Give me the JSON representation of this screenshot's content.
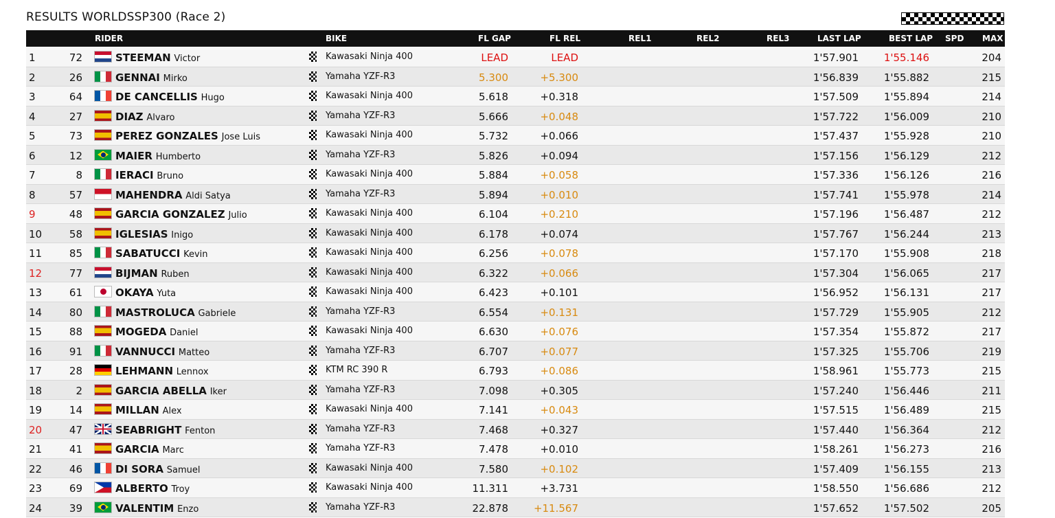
{
  "title": "RESULTS WORLDSSP300  (Race 2)",
  "headers": {
    "rider": "RIDER",
    "bike": "BIKE",
    "fl_gap": "FL GAP",
    "fl_rel": "FL REL",
    "rel1": "REL1",
    "rel2": "REL2",
    "rel3": "REL3",
    "last_lap": "LAST LAP",
    "best_lap": "BEST LAP",
    "spd": "SPD",
    "max": "MAX"
  },
  "rows": [
    {
      "pos": "1",
      "num": "72",
      "flag": "NL",
      "last": "STEEMAN",
      "first": "Victor",
      "bike": "Kawasaki Ninja 400",
      "gap": "LEAD",
      "rel": "LEAD",
      "last_lap": "1'57.901",
      "best_lap": "1'55.146",
      "max": "204"
    },
    {
      "pos": "2",
      "num": "26",
      "flag": "IT",
      "last": "GENNAI",
      "first": "Mirko",
      "bike": "Yamaha YZF-R3",
      "gap": "5.300",
      "rel": "+5.300",
      "last_lap": "1'56.839",
      "best_lap": "1'55.882",
      "max": "215"
    },
    {
      "pos": "3",
      "num": "64",
      "flag": "FR",
      "last": "DE CANCELLIS",
      "first": "Hugo",
      "bike": "Kawasaki Ninja 400",
      "gap": "5.618",
      "rel": "+0.318",
      "last_lap": "1'57.509",
      "best_lap": "1'55.894",
      "max": "214"
    },
    {
      "pos": "4",
      "num": "27",
      "flag": "ES",
      "last": "DIAZ",
      "first": "Alvaro",
      "bike": "Yamaha YZF-R3",
      "gap": "5.666",
      "rel": "+0.048",
      "last_lap": "1'57.722",
      "best_lap": "1'56.009",
      "max": "210"
    },
    {
      "pos": "5",
      "num": "73",
      "flag": "ES",
      "last": "PEREZ GONZALES",
      "first": "Jose Luis",
      "bike": "Kawasaki Ninja 400",
      "gap": "5.732",
      "rel": "+0.066",
      "last_lap": "1'57.437",
      "best_lap": "1'55.928",
      "max": "210"
    },
    {
      "pos": "6",
      "num": "12",
      "flag": "BR",
      "last": "MAIER",
      "first": "Humberto",
      "bike": "Yamaha YZF-R3",
      "gap": "5.826",
      "rel": "+0.094",
      "last_lap": "1'57.156",
      "best_lap": "1'56.129",
      "max": "212"
    },
    {
      "pos": "7",
      "num": "8",
      "flag": "IT",
      "last": "IERACI",
      "first": "Bruno",
      "bike": "Kawasaki Ninja 400",
      "gap": "5.884",
      "rel": "+0.058",
      "last_lap": "1'57.336",
      "best_lap": "1'56.126",
      "max": "216"
    },
    {
      "pos": "8",
      "num": "57",
      "flag": "ID",
      "last": "MAHENDRA",
      "first": "Aldi Satya",
      "bike": "Yamaha YZF-R3",
      "gap": "5.894",
      "rel": "+0.010",
      "last_lap": "1'57.741",
      "best_lap": "1'55.978",
      "max": "214"
    },
    {
      "pos": "9",
      "num": "48",
      "flag": "ES",
      "last": "GARCIA GONZALEZ",
      "first": "Julio",
      "bike": "Kawasaki Ninja 400",
      "gap": "6.104",
      "rel": "+0.210",
      "last_lap": "1'57.196",
      "best_lap": "1'56.487",
      "max": "212"
    },
    {
      "pos": "10",
      "num": "58",
      "flag": "ES",
      "last": "IGLESIAS",
      "first": "Inigo",
      "bike": "Kawasaki Ninja 400",
      "gap": "6.178",
      "rel": "+0.074",
      "last_lap": "1'57.767",
      "best_lap": "1'56.244",
      "max": "213"
    },
    {
      "pos": "11",
      "num": "85",
      "flag": "IT",
      "last": "SABATUCCI",
      "first": "Kevin",
      "bike": "Kawasaki Ninja 400",
      "gap": "6.256",
      "rel": "+0.078",
      "last_lap": "1'57.170",
      "best_lap": "1'55.908",
      "max": "218"
    },
    {
      "pos": "12",
      "num": "77",
      "flag": "NL",
      "last": "BIJMAN",
      "first": "Ruben",
      "bike": "Kawasaki Ninja 400",
      "gap": "6.322",
      "rel": "+0.066",
      "last_lap": "1'57.304",
      "best_lap": "1'56.065",
      "max": "217"
    },
    {
      "pos": "13",
      "num": "61",
      "flag": "JP",
      "last": "OKAYA",
      "first": "Yuta",
      "bike": "Kawasaki Ninja 400",
      "gap": "6.423",
      "rel": "+0.101",
      "last_lap": "1'56.952",
      "best_lap": "1'56.131",
      "max": "217"
    },
    {
      "pos": "14",
      "num": "80",
      "flag": "IT",
      "last": "MASTROLUCA",
      "first": "Gabriele",
      "bike": "Yamaha YZF-R3",
      "gap": "6.554",
      "rel": "+0.131",
      "last_lap": "1'57.729",
      "best_lap": "1'55.905",
      "max": "212"
    },
    {
      "pos": "15",
      "num": "88",
      "flag": "ES",
      "last": "MOGEDA",
      "first": "Daniel",
      "bike": "Kawasaki Ninja 400",
      "gap": "6.630",
      "rel": "+0.076",
      "last_lap": "1'57.354",
      "best_lap": "1'55.872",
      "max": "217"
    },
    {
      "pos": "16",
      "num": "91",
      "flag": "IT",
      "last": "VANNUCCI",
      "first": "Matteo",
      "bike": "Yamaha YZF-R3",
      "gap": "6.707",
      "rel": "+0.077",
      "last_lap": "1'57.325",
      "best_lap": "1'55.706",
      "max": "219"
    },
    {
      "pos": "17",
      "num": "28",
      "flag": "DE",
      "last": "LEHMANN",
      "first": "Lennox",
      "bike": "KTM RC 390 R",
      "gap": "6.793",
      "rel": "+0.086",
      "last_lap": "1'58.961",
      "best_lap": "1'55.773",
      "max": "215"
    },
    {
      "pos": "18",
      "num": "2",
      "flag": "ES",
      "last": "GARCIA ABELLA",
      "first": "Iker",
      "bike": "Yamaha YZF-R3",
      "gap": "7.098",
      "rel": "+0.305",
      "last_lap": "1'57.240",
      "best_lap": "1'56.446",
      "max": "211"
    },
    {
      "pos": "19",
      "num": "14",
      "flag": "ES",
      "last": "MILLAN",
      "first": "Alex",
      "bike": "Kawasaki Ninja 400",
      "gap": "7.141",
      "rel": "+0.043",
      "last_lap": "1'57.515",
      "best_lap": "1'56.489",
      "max": "215"
    },
    {
      "pos": "20",
      "num": "47",
      "flag": "GB",
      "last": "SEABRIGHT",
      "first": "Fenton",
      "bike": "Yamaha YZF-R3",
      "gap": "7.468",
      "rel": "+0.327",
      "last_lap": "1'57.440",
      "best_lap": "1'56.364",
      "max": "212"
    },
    {
      "pos": "21",
      "num": "41",
      "flag": "ES",
      "last": "GARCIA",
      "first": "Marc",
      "bike": "Yamaha YZF-R3",
      "gap": "7.478",
      "rel": "+0.010",
      "last_lap": "1'58.261",
      "best_lap": "1'56.273",
      "max": "216"
    },
    {
      "pos": "22",
      "num": "46",
      "flag": "FR",
      "last": "DI SORA",
      "first": "Samuel",
      "bike": "Kawasaki Ninja 400",
      "gap": "7.580",
      "rel": "+0.102",
      "last_lap": "1'57.409",
      "best_lap": "1'56.155",
      "max": "213"
    },
    {
      "pos": "23",
      "num": "69",
      "flag": "PH",
      "last": "ALBERTO",
      "first": "Troy",
      "bike": "Kawasaki Ninja 400",
      "gap": "11.311",
      "rel": "+3.731",
      "last_lap": "1'58.550",
      "best_lap": "1'56.686",
      "max": "212"
    },
    {
      "pos": "24",
      "num": "39",
      "flag": "BR",
      "last": "VALENTIM",
      "first": "Enzo",
      "bike": "Yamaha YZF-R3",
      "gap": "22.878",
      "rel": "+11.567",
      "last_lap": "1'57.652",
      "best_lap": "1'57.502",
      "max": "205"
    }
  ],
  "styles": {
    "red_positions": [
      "9",
      "12",
      "20"
    ],
    "orange_gap_rows": [
      "2"
    ],
    "orange_rel_rows": [
      "2",
      "4",
      "7",
      "8",
      "9",
      "11",
      "12",
      "14",
      "15",
      "16",
      "17",
      "19",
      "22",
      "24"
    ],
    "red_best_rows": [
      "1"
    ],
    "orange": "#d88a10",
    "red": "#d11111"
  }
}
